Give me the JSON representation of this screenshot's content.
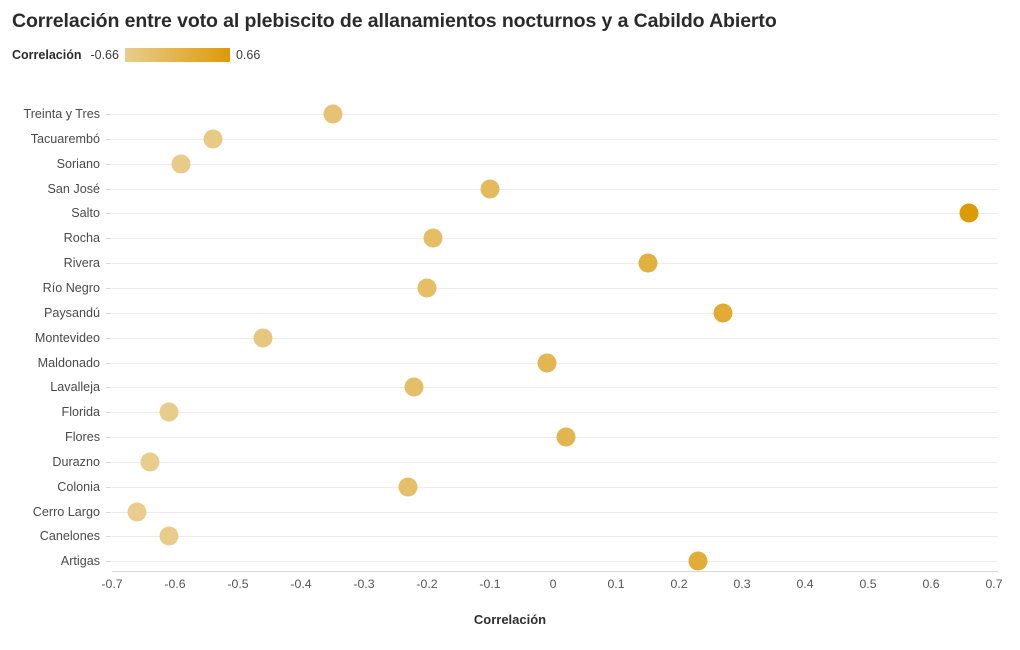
{
  "header": {
    "title": "Correlación entre voto al plebiscito de allanamientos nocturnos y a Cabildo Abierto"
  },
  "legend": {
    "title": "Correlación",
    "min_label": "-0.66",
    "max_label": "0.66",
    "gradient_start_color": "#e8cd8e",
    "gradient_end_color": "#dd9a07"
  },
  "chart_data": {
    "type": "scatter",
    "title": "Correlación entre voto al plebiscito de allanamientos nocturnos y a Cabildo Abierto",
    "xlabel": "Correlación",
    "ylabel": "",
    "xlim": [
      -0.75,
      0.75
    ],
    "xticks": [
      -0.7,
      -0.6,
      -0.5,
      -0.4,
      -0.3,
      -0.2,
      -0.1,
      0,
      0.1,
      0.2,
      0.3,
      0.4,
      0.5,
      0.6,
      0.7
    ],
    "xtick_labels": [
      "-0.7",
      "-0.6",
      "-0.5",
      "-0.4",
      "-0.3",
      "-0.2",
      "-0.1",
      "0",
      "0.1",
      "0.2",
      "0.3",
      "0.4",
      "0.5",
      "0.6",
      "0.7"
    ],
    "grid": true,
    "legend_position": "top-left",
    "color_scale": {
      "min": -0.66,
      "max": 0.66,
      "start_color": "#e8cd8e",
      "end_color": "#dd9a07"
    },
    "categories": [
      "Treinta y Tres",
      "Tacuarembó",
      "Soriano",
      "San José",
      "Salto",
      "Rocha",
      "Rivera",
      "Río Negro",
      "Paysandú",
      "Montevideo",
      "Maldonado",
      "Lavalleja",
      "Florida",
      "Flores",
      "Durazno",
      "Colonia",
      "Cerro Largo",
      "Canelones",
      "Artigas"
    ],
    "values": [
      -0.35,
      -0.54,
      -0.59,
      -0.1,
      0.66,
      -0.19,
      0.15,
      -0.2,
      0.27,
      -0.46,
      -0.01,
      -0.22,
      -0.61,
      0.02,
      -0.64,
      -0.23,
      -0.66,
      -0.61,
      0.23
    ]
  }
}
